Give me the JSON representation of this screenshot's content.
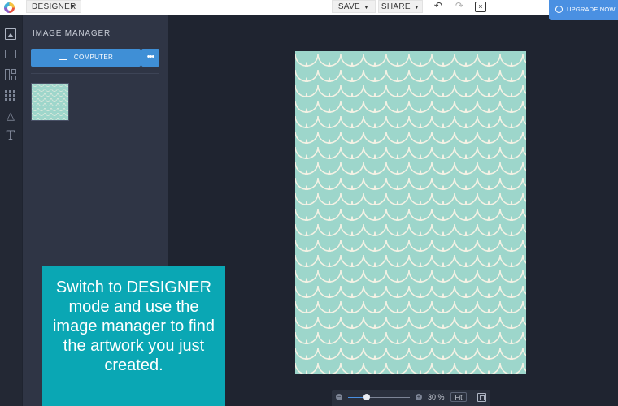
{
  "toolbar": {
    "mode_label": "DESIGNER",
    "save_label": "SAVE",
    "share_label": "SHARE",
    "upgrade_label": "UPGRADE NOW",
    "caret": "▼",
    "undo_glyph": "↶",
    "redo_glyph": "↷",
    "close_glyph": "×"
  },
  "rail": {
    "items": [
      "image-icon",
      "folder-icon",
      "layout-icon",
      "grid-icon",
      "triangle-icon",
      "text-icon"
    ],
    "text_glyph": "T",
    "triangle_glyph": "△"
  },
  "panel": {
    "title": "IMAGE MANAGER",
    "computer_label": "COMPUTER",
    "more_label": "•••"
  },
  "canvas": {
    "artboard_color": "#9dd6cb",
    "pattern_stroke": "#f4f1e4"
  },
  "zoom": {
    "value": 30,
    "display": "30 %",
    "fit_label": "Fit",
    "minus_glyph": "−",
    "plus_glyph": "+"
  },
  "callout": {
    "text": "Switch to DESIGNER mode and use the image manager to find the artwork you just created.",
    "background": "#0aa7b4"
  },
  "colors": {
    "accent": "#3f8fd6",
    "upgrade": "#4a90e2",
    "panel": "#2f3545",
    "workspace": "#1f2430"
  }
}
